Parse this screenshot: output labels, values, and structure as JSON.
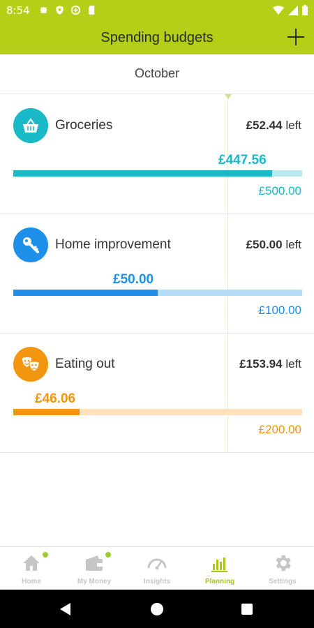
{
  "status_bar": {
    "time": "8:54"
  },
  "app_bar": {
    "title": "Spending budgets"
  },
  "month": "October",
  "budgets": [
    {
      "name": "Groceries",
      "left_amount": "£52.44",
      "left_suffix": "left",
      "spent": "£447.56",
      "total": "£500.00",
      "spent_fraction": 0.895,
      "color": "#19b9c8",
      "track_color": "#b8eaf0",
      "icon": "basket-icon"
    },
    {
      "name": "Home improvement",
      "left_amount": "£50.00",
      "left_suffix": "left",
      "spent": "£50.00",
      "total": "£100.00",
      "spent_fraction": 0.5,
      "color": "#1e90ea",
      "track_color": "#b5dcf9",
      "icon": "key-icon"
    },
    {
      "name": "Eating out",
      "left_amount": "£153.94",
      "left_suffix": "left",
      "spent": "£46.06",
      "total": "£200.00",
      "spent_fraction": 0.23,
      "color": "#f3960f",
      "track_color": "#fde2bd",
      "icon": "theatre-masks-icon"
    }
  ],
  "bottom_nav": [
    {
      "label": "Home",
      "icon": "home-icon",
      "dot": true
    },
    {
      "label": "My Money",
      "icon": "wallet-icon",
      "dot": true
    },
    {
      "label": "Insights",
      "icon": "gauge-icon",
      "dot": false
    },
    {
      "label": "Planning",
      "icon": "bar-chart-icon",
      "active": true,
      "dot": false
    },
    {
      "label": "Settings",
      "icon": "gear-icon",
      "dot": false
    }
  ],
  "colors": {
    "brand": "#b5cf18",
    "active_nav": "#a9c414"
  }
}
